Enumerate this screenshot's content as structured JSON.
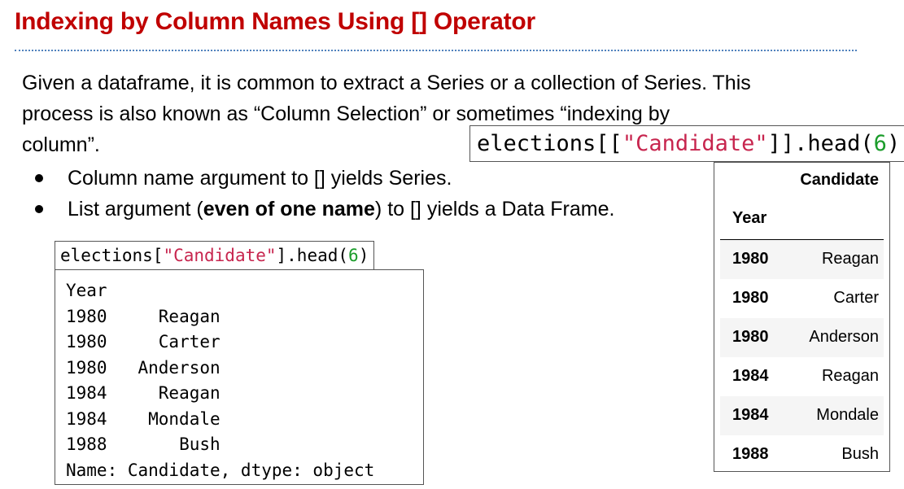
{
  "title": "Indexing by Column Names Using [] Operator",
  "intro": {
    "lines": [
      "Given a dataframe, it is common to extract a Series or a collection of Series. This",
      "process is also known as “Column Selection” or sometimes “indexing by",
      "column”."
    ]
  },
  "bullets": {
    "item1": "Column name argument to [] yields Series.",
    "item2_before": "List argument (",
    "item2_bold": "even of one name",
    "item2_after": ") to [] yields a Data Frame."
  },
  "series_code": {
    "prefix": "elections[",
    "string": "\"Candidate\"",
    "middle": "].head(",
    "number": "6",
    "suffix": ")"
  },
  "series_output": {
    "index_name": "Year",
    "rows": [
      {
        "year": "1980",
        "candidate": "Reagan"
      },
      {
        "year": "1980",
        "candidate": "Carter"
      },
      {
        "year": "1980",
        "candidate": "Anderson"
      },
      {
        "year": "1984",
        "candidate": "Reagan"
      },
      {
        "year": "1984",
        "candidate": "Mondale"
      },
      {
        "year": "1988",
        "candidate": "Bush"
      }
    ],
    "footer": "Name: Candidate, dtype: object"
  },
  "df_code": {
    "prefix": "elections[[",
    "string": "\"Candidate\"",
    "middle": "]].head(",
    "number": "6",
    "suffix": ")"
  },
  "df_output": {
    "column": "Candidate",
    "index_name": "Year",
    "rows": [
      {
        "year": "1980",
        "candidate": "Reagan"
      },
      {
        "year": "1980",
        "candidate": "Carter"
      },
      {
        "year": "1980",
        "candidate": "Anderson"
      },
      {
        "year": "1984",
        "candidate": "Reagan"
      },
      {
        "year": "1984",
        "candidate": "Mondale"
      },
      {
        "year": "1988",
        "candidate": "Bush"
      }
    ]
  },
  "colors": {
    "title": "#c00000",
    "rule": "#4f81bd",
    "code_string": "#c7254e",
    "code_number": "#1a9c2a"
  }
}
